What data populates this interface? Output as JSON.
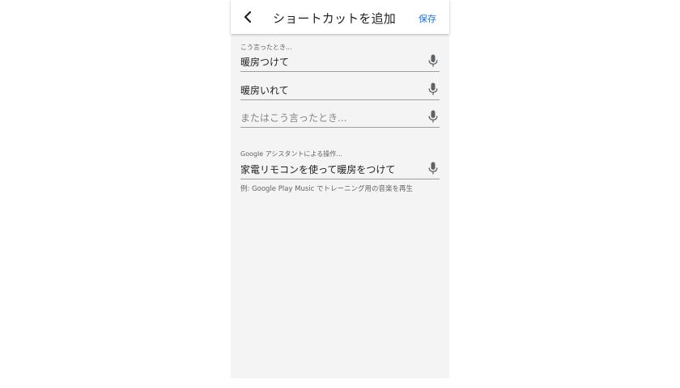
{
  "header": {
    "back_icon": "chevron-left-icon",
    "title": "ショートカットを追加",
    "save_label": "保存",
    "accent_color": "#1a73e8"
  },
  "phrases": {
    "section_label": "こう言ったとき...",
    "items": [
      {
        "text": "暖房つけて",
        "mic_icon": "microphone-icon"
      },
      {
        "text": "暖房いれて",
        "mic_icon": "microphone-icon"
      }
    ],
    "empty_placeholder": "またはこう言ったとき..."
  },
  "action": {
    "section_label": "Google アシスタントによる操作...",
    "text": "家電リモコンを使って暖房をつけて",
    "mic_icon": "microphone-icon",
    "hint": "例: Google Play Music でトレーニング用の音楽を再生"
  }
}
